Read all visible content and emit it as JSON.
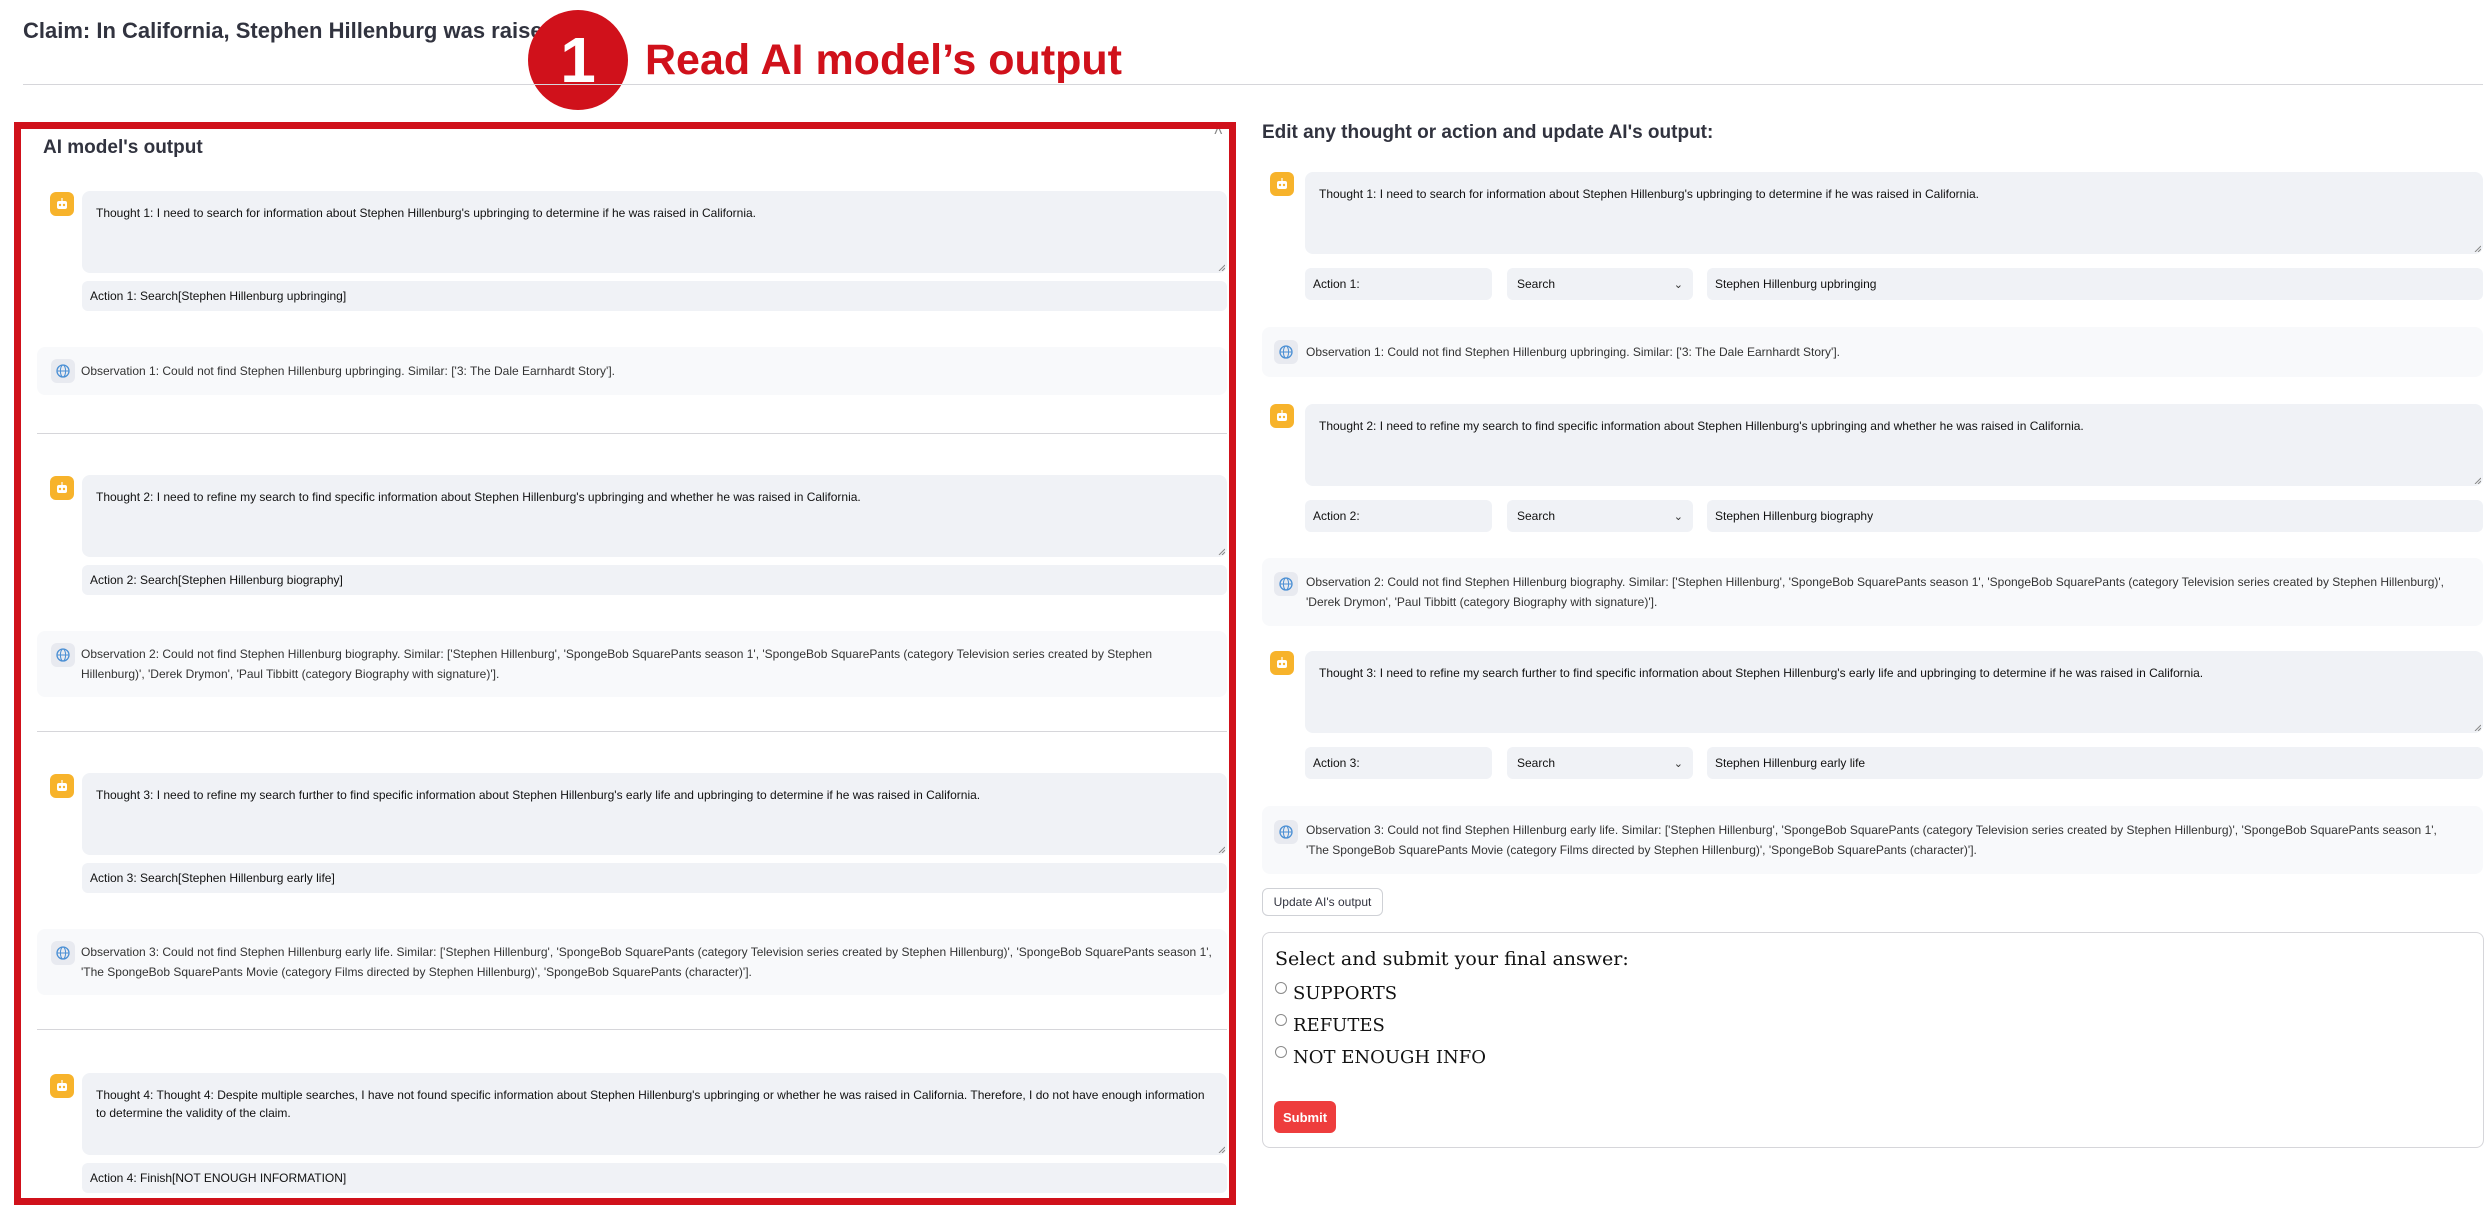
{
  "claim": "Claim: In California, Stephen Hillenburg was raised.",
  "callout": {
    "number": "1",
    "text": "Read AI model’s output"
  },
  "left_panel": {
    "title": "AI model's output",
    "collapse_icon": "chevron-up-icon",
    "steps": [
      {
        "thought": "Thought 1: I need to search for information about Stephen Hillenburg's upbringing to determine if he was raised in California.",
        "action": "Action 1: Search[Stephen Hillenburg upbringing]",
        "observation": "Observation 1: Could not find Stephen Hillenburg upbringing. Similar: ['3: The Dale Earnhardt Story']."
      },
      {
        "thought": "Thought 2: I need to refine my search to find specific information about Stephen Hillenburg's upbringing and whether he was raised in California.",
        "action": "Action 2: Search[Stephen Hillenburg biography]",
        "observation": "Observation 2: Could not find Stephen Hillenburg biography. Similar: ['Stephen Hillenburg', 'SpongeBob SquarePants season 1', 'SpongeBob SquarePants (category Television series created by Stephen Hillenburg)', 'Derek Drymon', 'Paul Tibbitt (category Biography with signature)']."
      },
      {
        "thought": "Thought 3: I need to refine my search further to find specific information about Stephen Hillenburg's early life and upbringing to determine if he was raised in California.",
        "action": "Action 3: Search[Stephen Hillenburg early life]",
        "observation": "Observation 3: Could not find Stephen Hillenburg early life. Similar: ['Stephen Hillenburg', 'SpongeBob SquarePants (category Television series created by Stephen Hillenburg)', 'SpongeBob SquarePants season 1', 'The SpongeBob SquarePants Movie (category Films directed by Stephen Hillenburg)', 'SpongeBob SquarePants (character)']."
      },
      {
        "thought": "Thought 4: Thought 4: Despite multiple searches, I have not found specific information about Stephen Hillenburg's upbringing or whether he was raised in California. Therefore, I do not have enough information to determine the validity of the claim.",
        "action": "Action 4: Finish[NOT ENOUGH INFORMATION]"
      }
    ]
  },
  "right_panel": {
    "title": "Edit any thought or action and update AI's output:",
    "steps": [
      {
        "thought": "Thought 1: I need to search for information about Stephen Hillenburg's upbringing to determine if he was raised in California.",
        "action_label": "Action 1:",
        "action_type": "Search",
        "action_arg": "Stephen Hillenburg upbringing",
        "observation": "Observation 1: Could not find Stephen Hillenburg upbringing. Similar: ['3: The Dale Earnhardt Story']."
      },
      {
        "thought": "Thought 2: I need to refine my search to find specific information about Stephen Hillenburg's upbringing and whether he was raised in California.",
        "action_label": "Action 2:",
        "action_type": "Search",
        "action_arg": "Stephen Hillenburg biography",
        "observation": "Observation 2: Could not find Stephen Hillenburg biography. Similar: ['Stephen Hillenburg', 'SpongeBob SquarePants season 1', 'SpongeBob SquarePants (category Television series created by Stephen Hillenburg)', 'Derek Drymon', 'Paul Tibbitt (category Biography with signature)']."
      },
      {
        "thought": "Thought 3: I need to refine my search further to find specific information about Stephen Hillenburg's early life and upbringing to determine if he was raised in California.",
        "action_label": "Action 3:",
        "action_type": "Search",
        "action_arg": "Stephen Hillenburg early life",
        "observation": "Observation 3: Could not find Stephen Hillenburg early life. Similar: ['Stephen Hillenburg', 'SpongeBob SquarePants (category Television series created by Stephen Hillenburg)', 'SpongeBob SquarePants season 1', 'The SpongeBob SquarePants Movie (category Films directed by Stephen Hillenburg)', 'SpongeBob SquarePants (character)']."
      }
    ],
    "update_button": "Update AI's output",
    "final": {
      "title": "Select and submit your final answer:",
      "options": [
        "SUPPORTS",
        "REFUTES",
        "NOT ENOUGH INFO"
      ],
      "submit": "Submit"
    }
  },
  "colors": {
    "accent_red": "#d0111b",
    "bot_avatar": "#f7b32b",
    "submit_red": "#ee3d3d",
    "field_bg": "#f0f2f6"
  },
  "icons": {
    "bot": "robot-icon",
    "observation": "globe-icon",
    "select": "chevron-down-icon"
  }
}
